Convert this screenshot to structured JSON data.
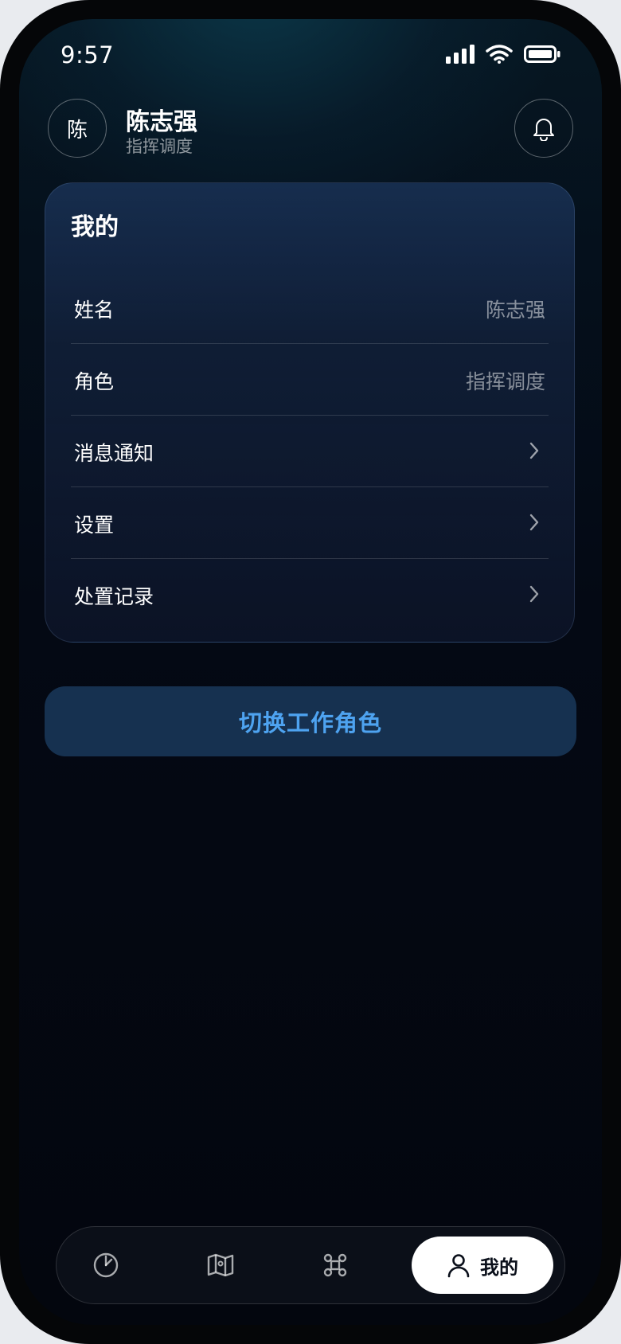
{
  "status_bar": {
    "time": "9:57"
  },
  "user": {
    "avatar_text": "陈",
    "name": "陈志强",
    "role": "指挥调度"
  },
  "card": {
    "title": "我的",
    "rows": [
      {
        "label": "姓名",
        "value": "陈志强"
      },
      {
        "label": "角色",
        "value": "指挥调度"
      },
      {
        "label": "消息通知"
      },
      {
        "label": "设置"
      },
      {
        "label": "处置记录"
      }
    ]
  },
  "actions": {
    "switch_role_label": "切换工作角色"
  },
  "tab_bar": {
    "tabs": [
      {
        "icon": "dashboard-gauge-icon"
      },
      {
        "icon": "map-icon"
      },
      {
        "icon": "command-icon"
      },
      {
        "icon": "person-icon",
        "label": "我的",
        "active": true
      }
    ]
  },
  "colors": {
    "accent": "#4ea3f0",
    "button_bg": "#163150",
    "card_border": "#2a3a56"
  }
}
